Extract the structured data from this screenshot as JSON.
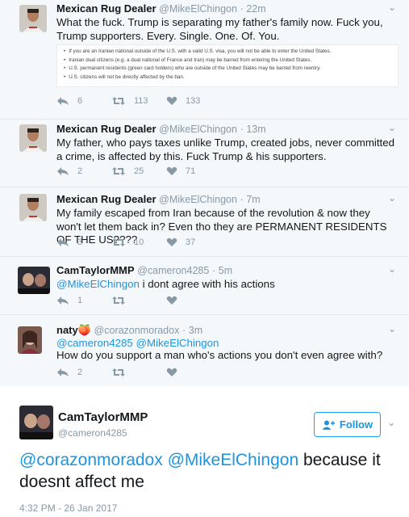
{
  "tweets": [
    {
      "name": "Mexican Rug Dealer",
      "handle": "@MikeElChingon",
      "time": "22m",
      "text": "What the fuck. Trump is separating my father's family now.  Fuck you, Trump supporters. Every. Single. One. Of. You.",
      "embed": [
        "If you are an Iranian national outside of the U.S. with a valid U.S. visa, you will not be able to enter the United States.",
        "Iranian dual citizens (e.g. a dual national of France and Iran) may be barred from entering the United States.",
        "U.S. permanent residents (green card holders) who are outside of the United States may be barred from reentry.",
        "U.S. citizens will not be directly affected by the ban."
      ],
      "replies": "6",
      "retweets": "113",
      "likes": "133"
    },
    {
      "name": "Mexican Rug Dealer",
      "handle": "@MikeElChingon",
      "time": "13m",
      "text": "My father, who pays taxes unlike Trump, created jobs, never committed a crime, is affected by this. Fuck Trump & his supporters.",
      "replies": "2",
      "retweets": "25",
      "likes": "71"
    },
    {
      "name": "Mexican Rug Dealer",
      "handle": "@MikeElChingon",
      "time": "7m",
      "text": "My family escaped from Iran because of the revolution & now they won't let them back in? Even tho they are PERMANENT RESIDENTS OF THE US????",
      "replies": "3",
      "retweets": "10",
      "likes": "37"
    },
    {
      "name": "CamTaylorMMP",
      "handle": "@cameron4285",
      "time": "5m",
      "mention": "@MikeElChingon",
      "text": " i dont agree with his actions",
      "replies": "1",
      "retweets": "",
      "likes": ""
    },
    {
      "name": "naty",
      "name_emoji": "🍑",
      "handle": "@corazonmoradox",
      "time": "3m",
      "mentions": "@cameron4285 @MikeElChingon",
      "text": "How do you support a man who's actions you don't even agree with?",
      "replies": "2",
      "retweets": "",
      "likes": ""
    }
  ],
  "separator": "·",
  "caret": "⌄",
  "main_tweet": {
    "name": "CamTaylorMMP",
    "handle": "@cameron4285",
    "follow_label": "Follow",
    "mentions": "@corazonmoradox @MikeElChingon",
    "text": " because it doesnt affect me",
    "timestamp": "4:32 PM - 26 Jan 2017"
  },
  "colors": {
    "link": "#1b95e0",
    "muted": "#8899a6",
    "background": "#f5f8fa"
  },
  "icons": [
    "reply-icon",
    "retweet-icon",
    "heart-icon",
    "caret-down-icon",
    "follow-person-icon"
  ]
}
